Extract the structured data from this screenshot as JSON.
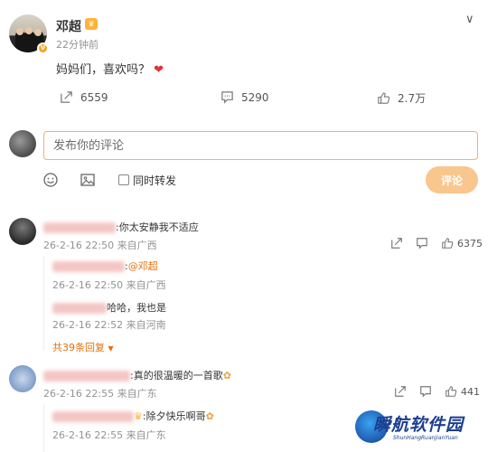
{
  "post": {
    "author": "邓超",
    "time": "22分钟前",
    "text": "妈妈们，喜欢吗？",
    "stats": {
      "reposts": "6559",
      "comments": "5290",
      "likes": "2.7万"
    }
  },
  "composer": {
    "placeholder": "发布你的评论",
    "forward_label": "同时转发",
    "submit_label": "评论"
  },
  "comments": [
    {
      "text": "你太安静我不适应",
      "time": "26-2-16 22:50",
      "location": "来自广西",
      "likes": "6375",
      "replies": [
        {
          "text": "@邓超",
          "time": "26-2-16 22:50",
          "location": "来自广西"
        },
        {
          "text": "哈哈，我也是",
          "time": "26-2-16 22:52",
          "location": "来自河南"
        }
      ],
      "more_replies": "共39条回复"
    },
    {
      "text": "真的很温暖的一首歌",
      "time": "26-2-16 22:55",
      "location": "来自广东",
      "likes": "441",
      "replies": [
        {
          "text": "除夕快乐啊哥",
          "time": "26-2-16 22:55",
          "location": "来自广东"
        }
      ]
    }
  ],
  "watermark": {
    "title": "瞬航软件园",
    "subtitle": "ShunHangRuanJianYuan"
  },
  "colors": {
    "accent": "#f3b26b",
    "link": "#e8700e",
    "heart": "#e0323c",
    "submit_bg": "#f9c68e"
  }
}
